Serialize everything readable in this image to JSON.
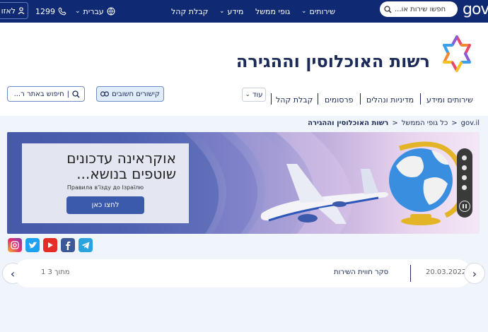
{
  "topbar": {
    "login_label": "לאזו",
    "phone": "1299",
    "language": "עברית",
    "search_placeholder": "חפשו שירות או...",
    "logo_text": "gov",
    "menu": [
      {
        "label": "שירותים",
        "has_dropdown": true
      },
      {
        "label": "גופי ממשל",
        "has_dropdown": false
      },
      {
        "label": "מידע",
        "has_dropdown": true
      },
      {
        "label": "קבלת קהל",
        "has_dropdown": false
      }
    ]
  },
  "header": {
    "title": "רשות האוכלוסין וההגירה",
    "nav": [
      "שירותים ומידע",
      "מדיניות ונהלים",
      "פרסומים",
      "קבלת קהל"
    ],
    "more_label": "עוד",
    "links_label": "קישורים חשובים",
    "site_search_placeholder": "חיפוש באתר ר..."
  },
  "breadcrumb": [
    "gov.il",
    "כל גופי הממשל",
    "רשות האוכלוסין וההגירה"
  ],
  "banner": {
    "heading_line1": "אוקראינה עדכונים",
    "heading_line2": "שוטפים בנושא...",
    "subtext": "Правила в'їзду до Ізраїлю",
    "button_label": "לחצו כאן"
  },
  "news": {
    "date": "20.03.2022",
    "text": "סקר חווית השירות",
    "counter": "1 מתוך 3"
  },
  "colors": {
    "topbar": "#0f2a72",
    "title": "#1b2a56",
    "button": "#3b5aab"
  }
}
